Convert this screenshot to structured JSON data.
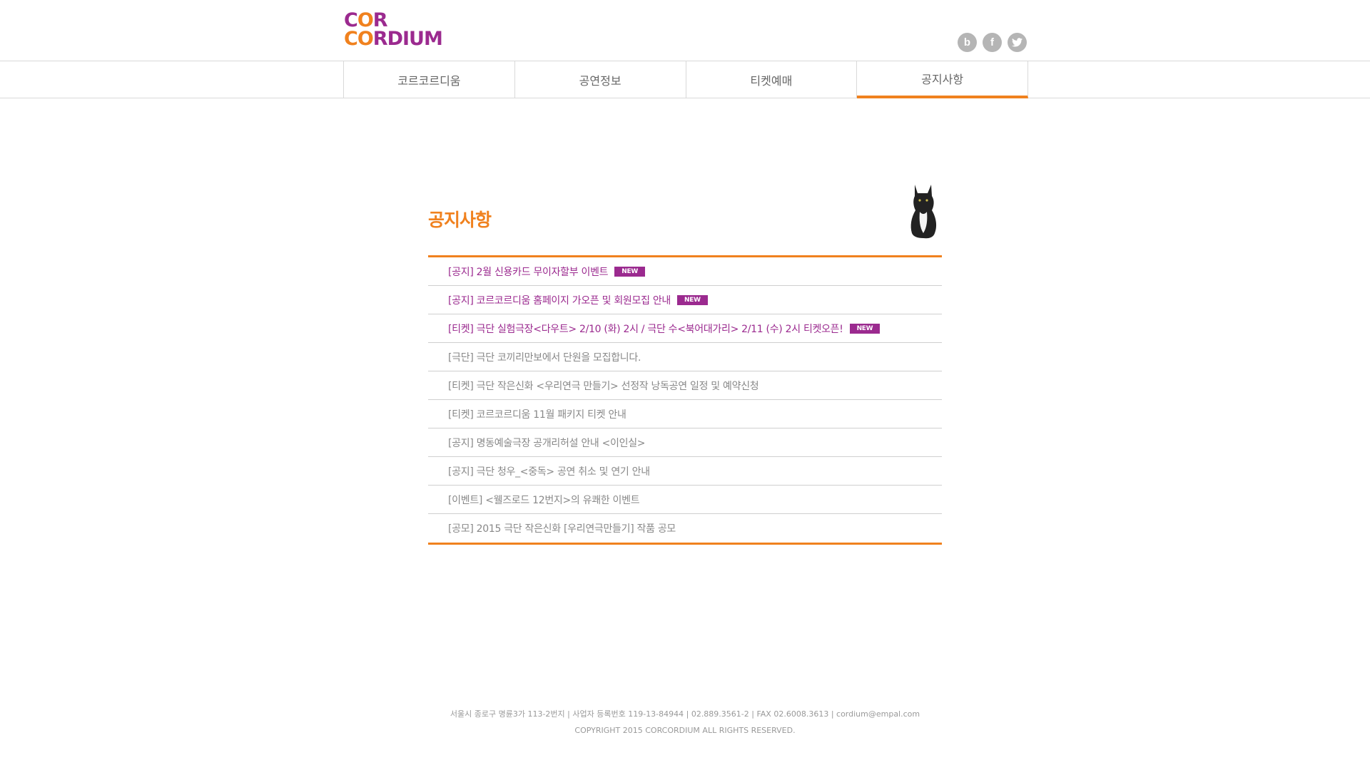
{
  "logo": {
    "line1_a": "C",
    "line1_b": "O",
    "line1_c": "R",
    "line2_a": "C",
    "line2_b": "O",
    "line2_c": "RDIUM"
  },
  "social": [
    {
      "glyph": "b",
      "icon": "blog-icon"
    },
    {
      "glyph": "f",
      "icon": "facebook-icon"
    },
    {
      "glyph": "t",
      "icon": "twitter-icon"
    }
  ],
  "nav": {
    "tabs": [
      {
        "label": "코르코르디움"
      },
      {
        "label": "공연정보"
      },
      {
        "label": "티켓예매"
      },
      {
        "label": "공지사항",
        "active": true
      }
    ]
  },
  "notice": {
    "title": "공지사항",
    "items": [
      {
        "text": "[공지] 2월 신용카드 무이자할부 이벤트",
        "badge": "NEW"
      },
      {
        "text": "[공지] 코르코르디움 홈페이지 가오픈 및 회원모집 안내",
        "badge": "NEW"
      },
      {
        "text": "[티켓] 극단 실험극장<다우트> 2/10 (화) 2시 / 극단 수<북어대가리> 2/11 (수) 2시 티켓오픈!",
        "badge": "NEW"
      },
      {
        "text": "[극단] 극단 코끼리만보에서 단원을 모집합니다."
      },
      {
        "text": "[티켓] 극단 작은신화 <우리연극 만들기> 선정작 낭독공연 일정 및 예약신청"
      },
      {
        "text": "[티켓] 코르코르디움 11월 패키지 티켓 안내"
      },
      {
        "text": "[공지] 명동예술극장 공개리허설 안내 <이인실>"
      },
      {
        "text": "[공지] 극단 청우_<중독> 공연 취소 및 연기 안내"
      },
      {
        "text": "[이벤트] <웰즈로드 12번지>의 유쾌한 이벤트"
      },
      {
        "text": "[공모] 2015 극단 작은신화 [우리연극만들기] 작품 공모"
      }
    ]
  },
  "footer": {
    "address": "서울시 종로구 명륜3가 113-2번지 | 사업자 등록번호 119-13-84944 | 02.889.3561-2 | FAX 02.6008.3613 | cordium@empal.com",
    "copyright": "COPYRIGHT 2015 CORCORDIUM ALL RIGHTS RESERVED."
  },
  "colors": {
    "accent": "#f0811e",
    "brand": "#9b2a8f",
    "icon_gray": "#b5b5b5"
  }
}
